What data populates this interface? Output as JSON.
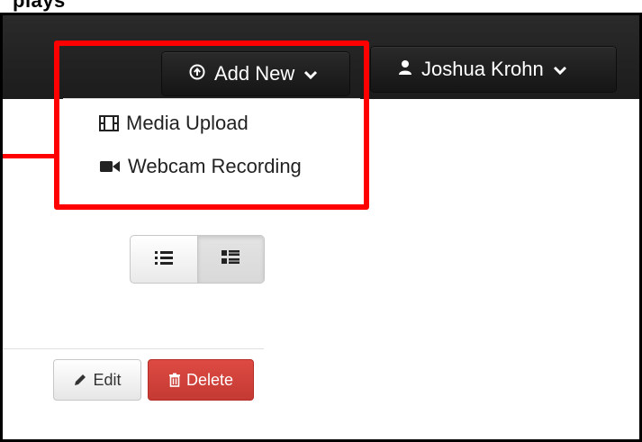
{
  "header": {
    "clipped_title": "plays",
    "add_new_label": "Add New",
    "user_label": "Joshua Krohn"
  },
  "dropdown": {
    "items": [
      {
        "label": "Media Upload",
        "icon": "film-icon"
      },
      {
        "label": "Webcam Recording",
        "icon": "video-camera-icon"
      }
    ]
  },
  "view_toggle": {
    "options": [
      "list-view",
      "detailed-list-view"
    ],
    "active": "detailed-list-view"
  },
  "actions": {
    "edit_label": "Edit",
    "delete_label": "Delete"
  },
  "colors": {
    "highlight": "#ff0000",
    "navbar": "#1f1f1f",
    "delete": "#d9423b"
  }
}
